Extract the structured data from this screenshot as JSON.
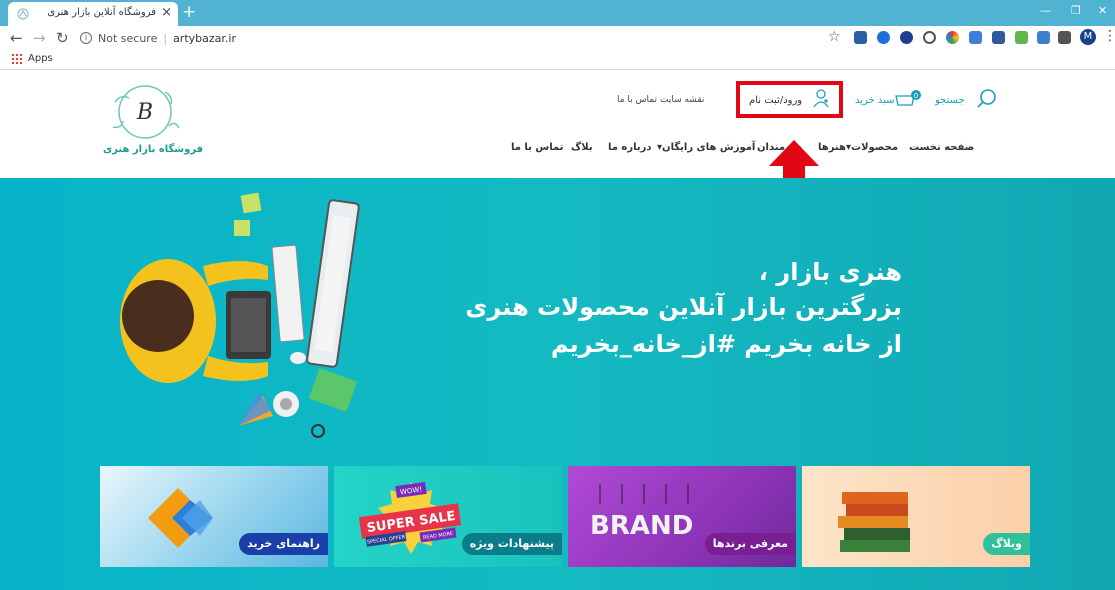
{
  "browser": {
    "tab_title": "فروشگاه آنلاین بازار هنری",
    "tab_close": "×",
    "new_tab": "+",
    "security": "Not secure",
    "url": "artybazar.ir",
    "bookmarks_apps": "Apps",
    "profile_initial": "M",
    "colors": {
      "tabbar": "#4fb3d1"
    }
  },
  "header": {
    "logo_text": "فروشگاه بازار هنری",
    "top_links": {
      "contact": "تماس با ما",
      "sitemap": "نقشه سایت"
    },
    "login": "ورود/ثبت نام",
    "cart": "سبد خرید",
    "cart_count": "0",
    "search": "جستجو"
  },
  "nav": {
    "items": [
      {
        "label": "صفحه نخست"
      },
      {
        "label": "محصولات"
      },
      {
        "label": "هنرها"
      },
      {
        "label": "هنرمندان"
      },
      {
        "label": "آموزش های رایگان"
      },
      {
        "label": "درباره ما"
      },
      {
        "label": "بلاگ"
      },
      {
        "label": "تماس با ما"
      }
    ]
  },
  "hero": {
    "line1": "هنری بازار ،",
    "line2": "بزرگترین بازار آنلاین محصولات هنری",
    "line3": "از خانه بخریم #از_خانه_بخریم"
  },
  "cards": [
    {
      "label": "راهنمای خرید",
      "color": "#1a3fa8"
    },
    {
      "label": "پیشنهادات ویژه",
      "color": "#0b7d8a",
      "art": {
        "badge": "WOW!",
        "title": "SUPER SALE",
        "sub1": "SPECIAL OFFER",
        "sub2": "READ MORE"
      }
    },
    {
      "label": "معرفی برندها",
      "color": "#7a1e94",
      "art": {
        "word": "BRAND"
      }
    },
    {
      "label": "وبلاگ",
      "color": "#2fbf9a"
    }
  ]
}
